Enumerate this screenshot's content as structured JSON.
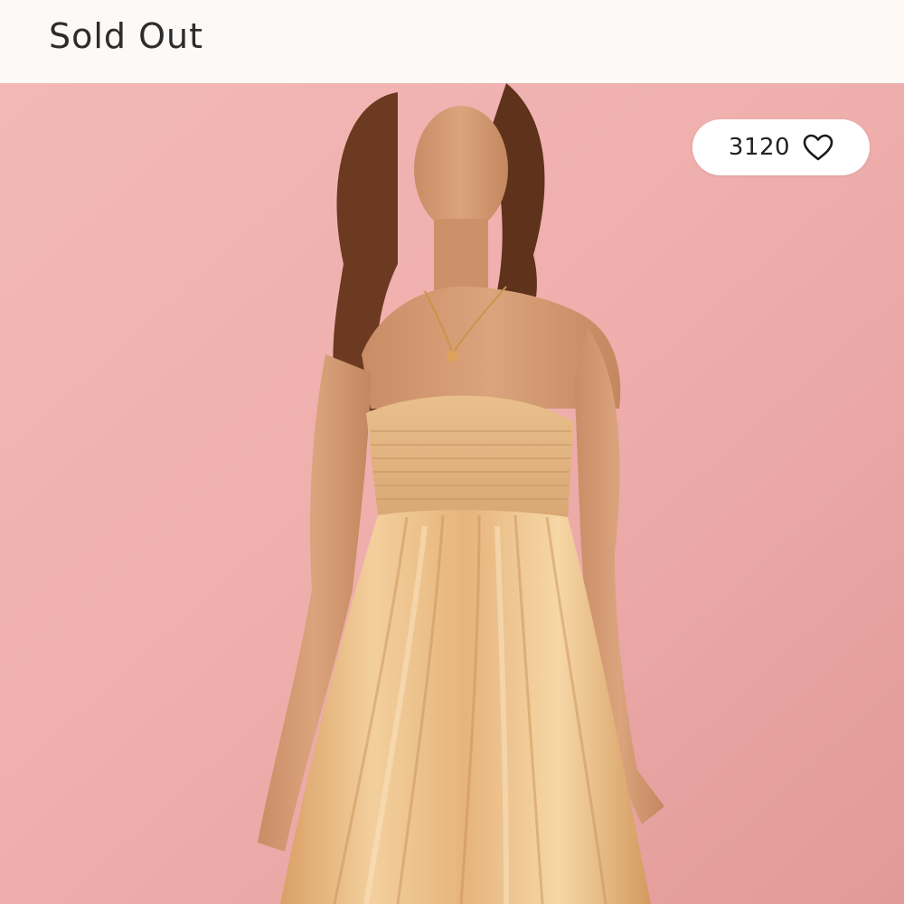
{
  "product": {
    "status_text": "Sold Out",
    "like_count": "3120",
    "like_icon": "heart-outline-icon",
    "image_subject": "model-in-gold-satin-strapless-dress"
  },
  "colors": {
    "background": "#fdf9f7",
    "photo_backdrop": "#eba9a9",
    "dress": "#e8b97a",
    "text": "#2c2c2c"
  }
}
